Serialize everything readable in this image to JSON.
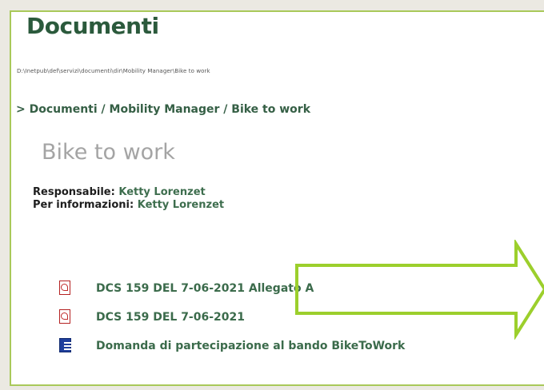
{
  "header": {
    "title": "Documenti"
  },
  "path": "D:\\Inetpub\\def\\servizi\\documenti\\dir\\Mobility Manager\\Bike to work",
  "breadcrumb": {
    "prefix": "> ",
    "items": [
      {
        "label": "Documenti"
      },
      {
        "label": "Mobility Manager"
      },
      {
        "label": "Bike to work"
      }
    ],
    "separator": " / "
  },
  "section": {
    "title": "Bike to work"
  },
  "meta": {
    "responsabile_label": "Responsabile:",
    "responsabile_name": "Ketty Lorenzet",
    "info_label": "Per informazioni:",
    "info_name": "Ketty Lorenzet"
  },
  "documents": [
    {
      "icon": "pdf-icon",
      "label": "DCS 159 DEL 7-06-2021 Allegato A"
    },
    {
      "icon": "pdf-icon",
      "label": "DCS 159 DEL 7-06-2021"
    },
    {
      "icon": "word-doc-icon",
      "label": "Domanda di partecipazione al bando BikeToWork"
    }
  ],
  "colors": {
    "accent_green": "#a9c95a",
    "title_green": "#2b5a3c",
    "link_green": "#3b6b4b",
    "pdf_red": "#b42222",
    "word_blue": "#1f3f9c"
  }
}
